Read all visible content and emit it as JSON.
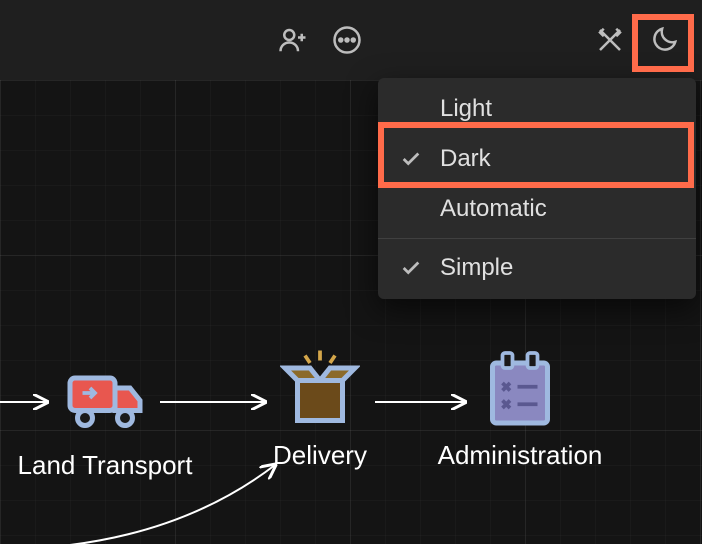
{
  "toolbar": {
    "icons": [
      "add-person",
      "more",
      "design-tools",
      "theme"
    ]
  },
  "theme_menu": {
    "items": [
      {
        "label": "Light",
        "checked": false
      },
      {
        "label": "Dark",
        "checked": true
      },
      {
        "label": "Automatic",
        "checked": false
      }
    ],
    "divider_after": 2,
    "extra": [
      {
        "label": "Simple",
        "checked": true
      }
    ]
  },
  "nodes": {
    "land": {
      "label": "Land Transport"
    },
    "delivery": {
      "label": "Delivery"
    },
    "admin": {
      "label": "Administration"
    }
  },
  "colors": {
    "highlight": "#ff6b4a",
    "icon_stroke": "#9fb9e0",
    "truck_fill": "#e8574f",
    "box_fill": "#6b4a1a",
    "clipboard_fill": "#8a88c0"
  }
}
